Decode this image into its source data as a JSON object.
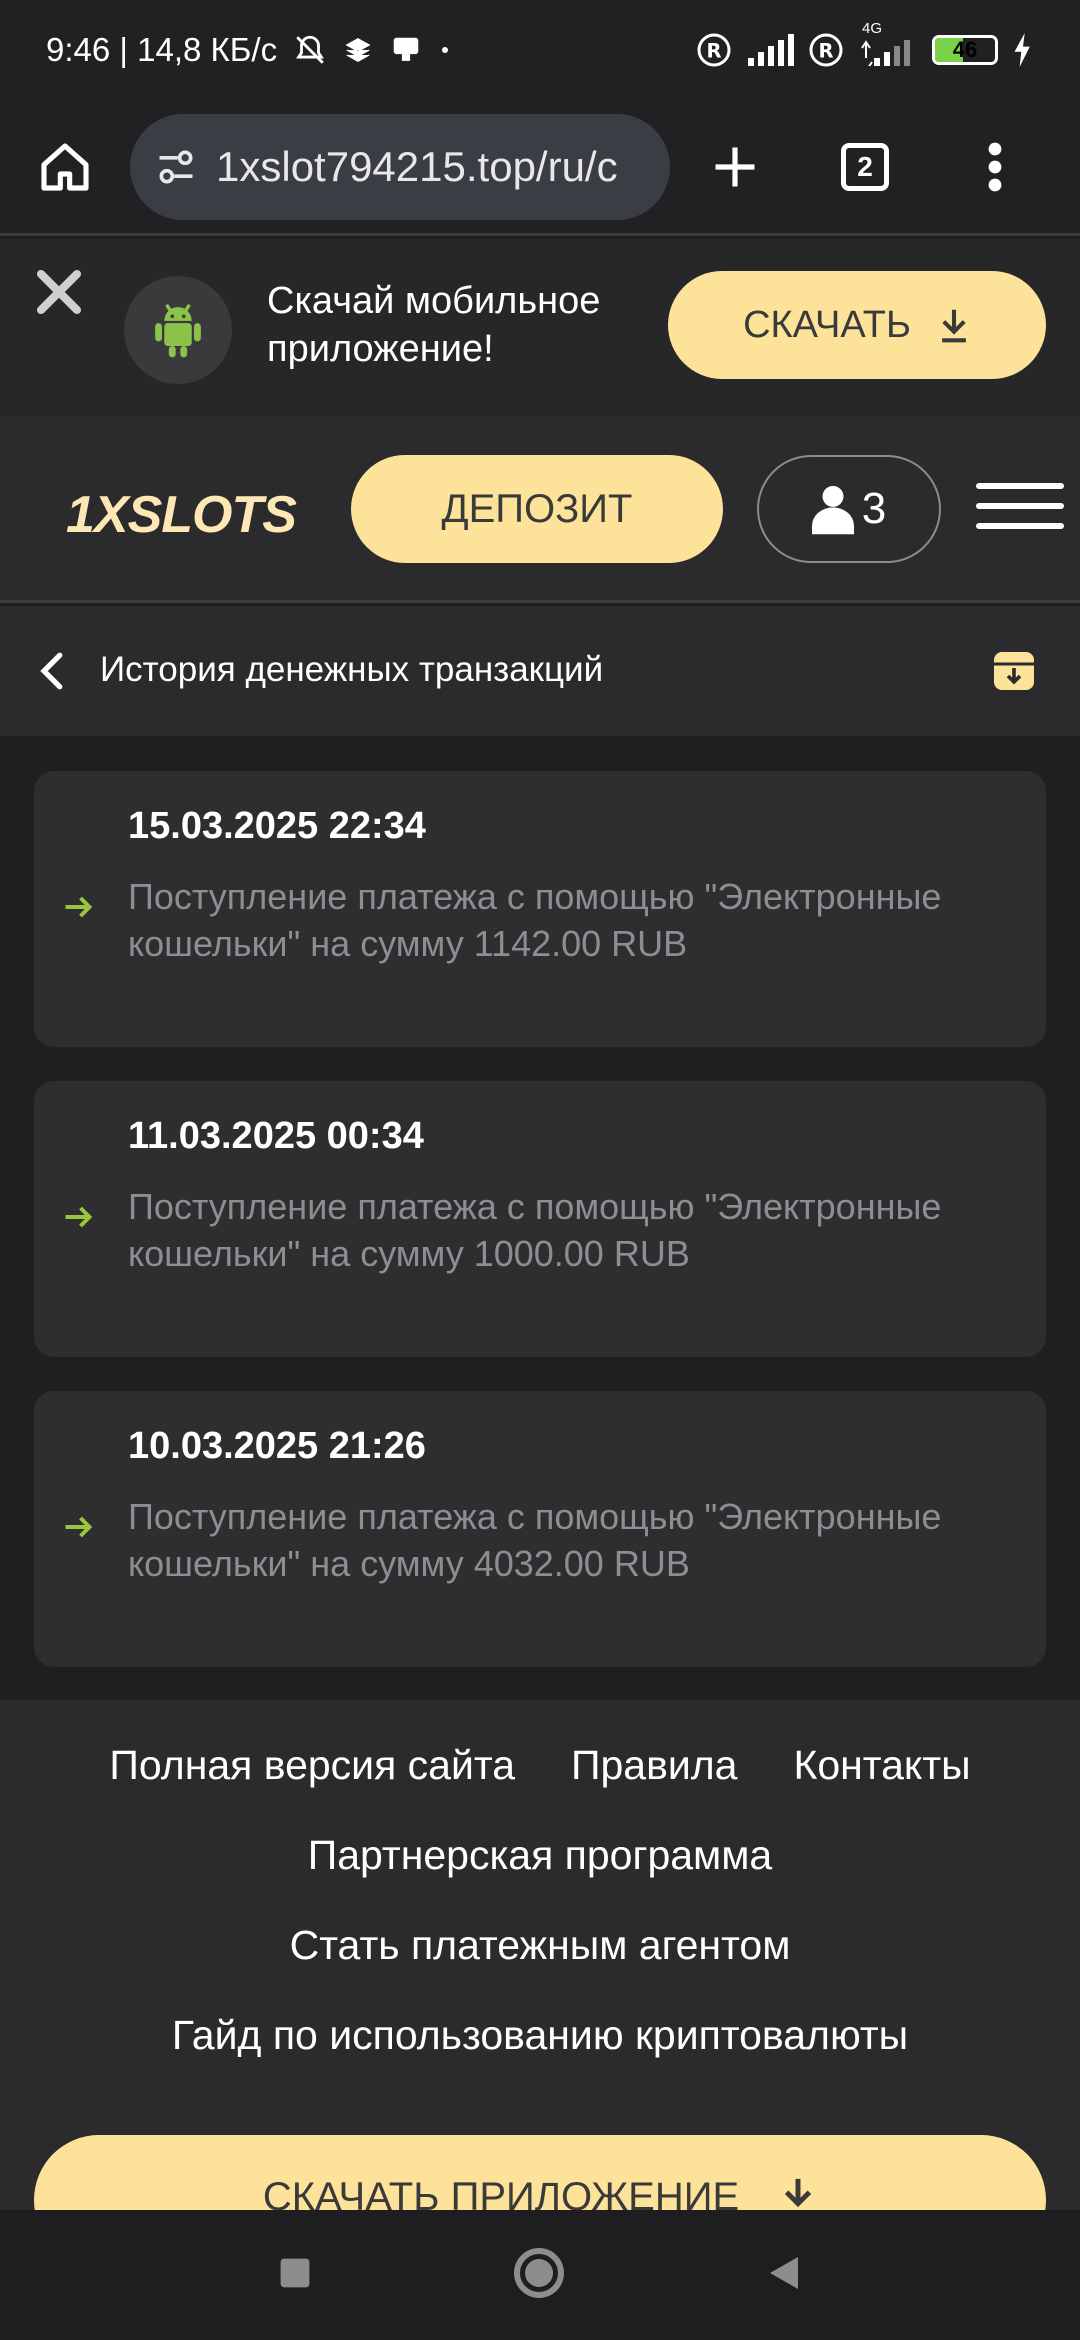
{
  "status_bar": {
    "time_speed": "9:46 | 14,8 КБ/с",
    "network_label": "4G",
    "battery": "46",
    "battery_level": 0.46
  },
  "browser": {
    "url": "1xslot794215.top/ru/c",
    "tab_count": "2"
  },
  "app_banner": {
    "text_line1": "Скачай мобильное",
    "text_line2": "приложение!",
    "download_label": "СКАЧАТЬ"
  },
  "header": {
    "logo": "1XSLOTS",
    "deposit_label": "ДЕПОЗИТ",
    "account_count": "3"
  },
  "page": {
    "title": "История денежных транзакций"
  },
  "transactions": [
    {
      "date": "15.03.2025 22:34",
      "description": "Поступление платежа с помощью \"Электронные кошельки\" на сумму 1142.00 RUB"
    },
    {
      "date": "11.03.2025 00:34",
      "description": "Поступление платежа с помощью \"Электронные кошельки\" на сумму 1000.00 RUB"
    },
    {
      "date": "10.03.2025 21:26",
      "description": "Поступление платежа с помощью \"Электронные кошельки\" на сумму 4032.00 RUB"
    }
  ],
  "footer": {
    "links_row1": [
      "Полная версия сайта",
      "Правила",
      "Контакты"
    ],
    "link_partner": "Партнерская программа",
    "link_agent": "Стать платежным агентом",
    "link_crypto": "Гайд по использованию криптовалюты",
    "download_app_label": "СКАЧАТЬ ПРИЛОЖЕНИЕ"
  },
  "colors": {
    "accent": "#fde39a",
    "arrow_green": "#9bc53d",
    "background": "#1f1f22"
  }
}
